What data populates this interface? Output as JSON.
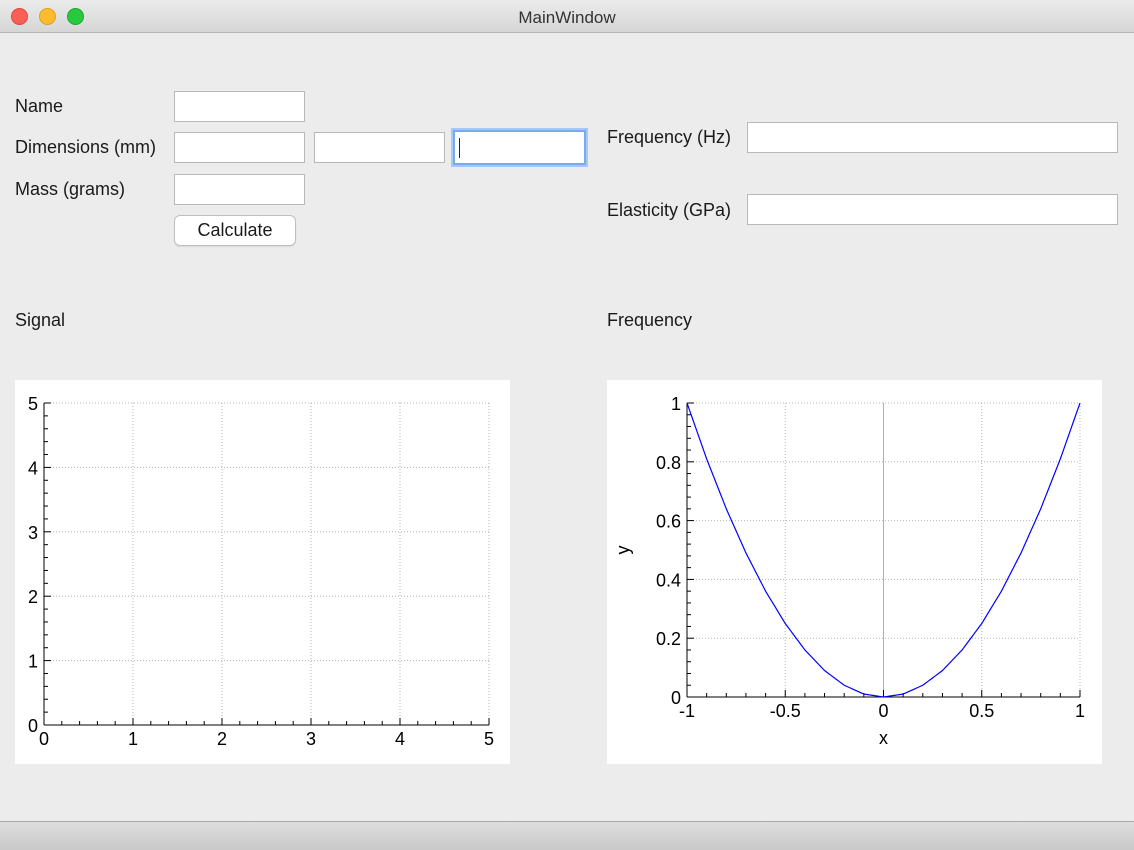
{
  "window": {
    "title": "MainWindow"
  },
  "form": {
    "name_label": "Name",
    "name_value": "",
    "dimensions_label": "Dimensions (mm)",
    "dim1_value": "",
    "dim2_value": "",
    "dim3_value": "",
    "mass_label": "Mass (grams)",
    "mass_value": "",
    "calculate_label": "Calculate",
    "frequency_label": "Frequency (Hz)",
    "frequency_value": "",
    "elasticity_label": "Elasticity (GPa)",
    "elasticity_value": ""
  },
  "plots": {
    "signal_title": "Signal",
    "frequency_title": "Frequency"
  },
  "chart_data": [
    {
      "type": "line",
      "xlabel": "",
      "ylabel": "",
      "xlim": [
        0,
        5
      ],
      "ylim": [
        0,
        5
      ],
      "x_ticks": [
        "0",
        "1",
        "2",
        "3",
        "4",
        "5"
      ],
      "y_ticks": [
        "0",
        "1",
        "2",
        "3",
        "4",
        "5"
      ],
      "grid": true,
      "series": []
    },
    {
      "type": "line",
      "xlabel": "x",
      "ylabel": "y",
      "xlim": [
        -1,
        1
      ],
      "ylim": [
        0,
        1
      ],
      "x_ticks": [
        "-1",
        "-0.5",
        "0",
        "0.5",
        "1"
      ],
      "y_ticks": [
        "0",
        "0.2",
        "0.4",
        "0.6",
        "0.8",
        "1"
      ],
      "grid": true,
      "line_color": "#0000ff",
      "series": [
        {
          "x": [
            -1,
            -0.9,
            -0.8,
            -0.7,
            -0.6,
            -0.5,
            -0.4,
            -0.3,
            -0.2,
            -0.1,
            0,
            0.1,
            0.2,
            0.3,
            0.4,
            0.5,
            0.6,
            0.7,
            0.8,
            0.9,
            1
          ],
          "y": [
            1,
            0.81,
            0.64,
            0.49,
            0.36,
            0.25,
            0.16,
            0.09,
            0.04,
            0.01,
            0,
            0.01,
            0.04,
            0.09,
            0.16,
            0.25,
            0.36,
            0.49,
            0.64,
            0.81,
            1
          ]
        }
      ]
    }
  ]
}
